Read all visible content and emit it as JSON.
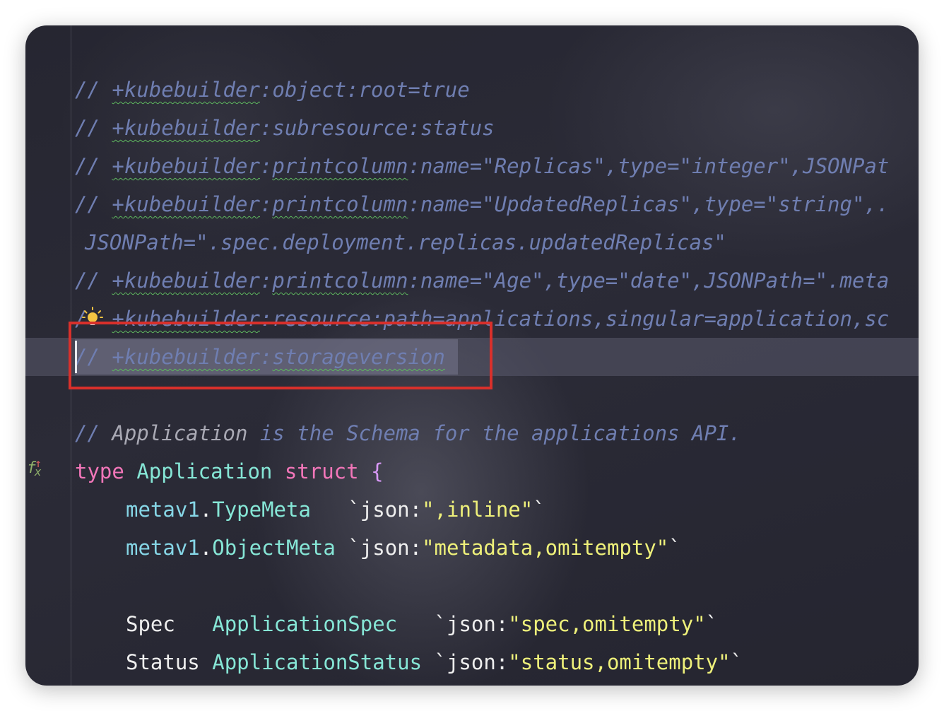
{
  "editor": {
    "lines": [
      {
        "slash": "//",
        "tag": "+kubebuilder",
        "colon": ":",
        "rest": "object:root=true"
      },
      {
        "slash": "//",
        "tag": "+kubebuilder",
        "colon": ":",
        "rest": "subresource:status"
      },
      {
        "slash": "//",
        "tag": "+kubebuilder",
        "colon": ":",
        "marker": "printcolumn",
        "rest": ":name=\"Replicas\",type=\"integer\",JSONPat"
      },
      {
        "slash": "//",
        "tag": "+kubebuilder",
        "colon": ":",
        "marker": "printcolumn",
        "rest": ":name=\"UpdatedReplicas\",type=\"string\",."
      },
      {
        "rest": "JSONPath=\".spec.deployment.replicas.updatedReplicas\""
      },
      {
        "slash": "//",
        "tag": "+kubebuilder",
        "colon": ":",
        "marker": "printcolumn",
        "rest": ":name=\"Age\",type=\"date\",JSONPath=\".meta"
      },
      {
        "slash": "/",
        "tag": "+kubebuilder",
        "colon": ":",
        "rest": "resource:path=applications,singular=application,sc"
      },
      {
        "slash": "//",
        "tag": "+kubebuilder",
        "colon": ":",
        "rest": "storageversion"
      }
    ],
    "doc_comment": {
      "slash": "//",
      "word": "Application",
      "rest": "is the Schema for the applications API."
    },
    "struct": {
      "keyword_type": "type",
      "name": "Application",
      "keyword_struct": "struct",
      "open_brace": "{",
      "fields": [
        {
          "pkg": "metav1",
          "dot": ".",
          "type": "TypeMeta",
          "pad": "   ",
          "tag_open": "`json:",
          "tag_value": "\",inline\"",
          "tag_close": "`"
        },
        {
          "pkg": "metav1",
          "dot": ".",
          "type": "ObjectMeta",
          "pad": " ",
          "tag_open": "`json:",
          "tag_value": "\"metadata,omitempty\"",
          "tag_close": "`"
        },
        {
          "name": "Spec",
          "pad1": "   ",
          "type": "ApplicationSpec",
          "pad2": "   ",
          "tag_open": "`json:",
          "tag_value": "\"spec,omitempty\"",
          "tag_close": "`"
        },
        {
          "name": "Status",
          "pad1": " ",
          "type": "ApplicationStatus",
          "pad2": " ",
          "tag_open": "`json:",
          "tag_value": "\"status,omitempty\"",
          "tag_close": "`"
        }
      ]
    },
    "colors": {
      "comment": "#6f7eb1",
      "keyword": "#f276b9",
      "type": "#86e6d6",
      "string": "#eef07a",
      "highlight_box": "#d9302b"
    },
    "icons": {
      "bulb": "lightbulb-icon",
      "gutter": "function-override-icon"
    },
    "gutter_label": "f",
    "gutter_sub": "x"
  }
}
